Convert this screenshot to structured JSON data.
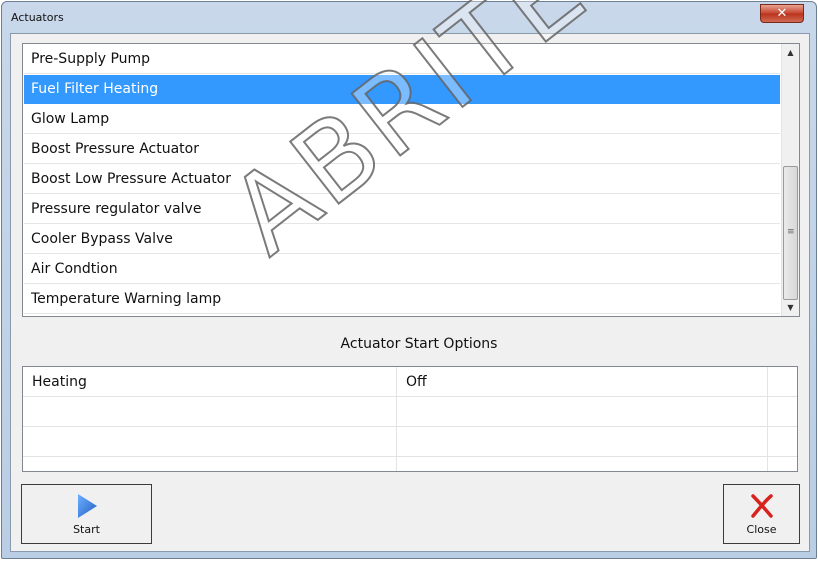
{
  "window": {
    "title": "Actuators",
    "close_glyph": "✕"
  },
  "actuator_list": {
    "items": [
      {
        "label": "Pre-Supply Pump",
        "selected": false
      },
      {
        "label": "Fuel Filter Heating",
        "selected": true
      },
      {
        "label": "Glow Lamp",
        "selected": false
      },
      {
        "label": "Boost Pressure Actuator",
        "selected": false
      },
      {
        "label": "Boost Low Pressure Actuator",
        "selected": false
      },
      {
        "label": "Pressure regulator valve",
        "selected": false
      },
      {
        "label": "Cooler Bypass Valve",
        "selected": false
      },
      {
        "label": "Air Condtion",
        "selected": false
      },
      {
        "label": "Temperature Warning lamp",
        "selected": false
      }
    ]
  },
  "start_options": {
    "title": "Actuator Start Options",
    "rows": [
      {
        "name": "Heating",
        "value": "Off"
      },
      {
        "name": "",
        "value": ""
      },
      {
        "name": "",
        "value": ""
      },
      {
        "name": "",
        "value": ""
      }
    ]
  },
  "buttons": {
    "start_label": "Start",
    "close_label": "Close",
    "start_icon": "play-icon",
    "close_icon": "red-x-icon"
  },
  "watermark": "ABRITES",
  "colors": {
    "selection": "#3399ff",
    "play": "#2f7fe0",
    "close_x": "#d8221b"
  }
}
